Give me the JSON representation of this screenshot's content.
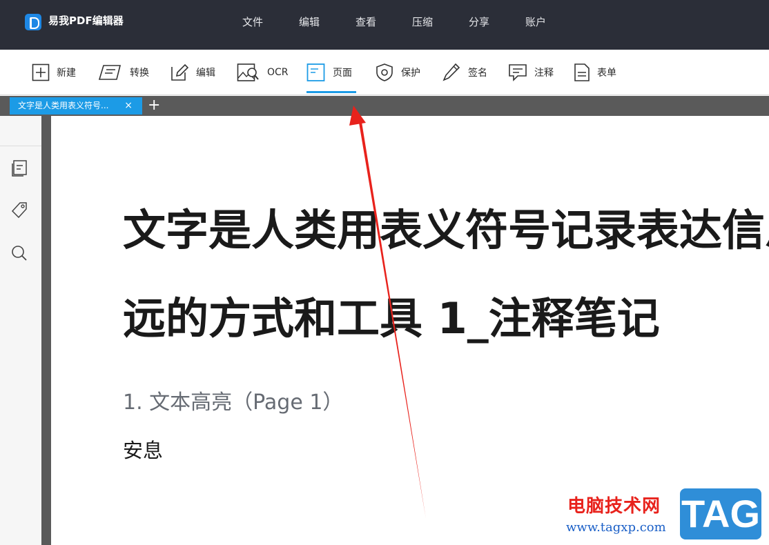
{
  "app": {
    "name": "易我PDF编辑器",
    "menu": [
      "文件",
      "编辑",
      "查看",
      "压缩",
      "分享",
      "账户"
    ]
  },
  "toolbar": {
    "tools": [
      {
        "label": "新建",
        "icon": "new-plus-icon"
      },
      {
        "label": "转换",
        "icon": "convert-icon"
      },
      {
        "label": "编辑",
        "icon": "edit-pencil-icon"
      },
      {
        "label": "OCR",
        "icon": "ocr-image-search-icon"
      },
      {
        "label": "页面",
        "icon": "page-icon",
        "active": true
      },
      {
        "label": "保护",
        "icon": "shield-icon"
      },
      {
        "label": "签名",
        "icon": "pen-icon"
      },
      {
        "label": "注释",
        "icon": "comment-icon"
      },
      {
        "label": "表单",
        "icon": "form-document-icon"
      }
    ],
    "active_color": "#1c9be6"
  },
  "tabs": {
    "doc_tab_title": "文字是人类用表义符号...",
    "close_glyph": "×",
    "new_tab_glyph": "+"
  },
  "sidebar": {
    "icons": [
      "thumbnails-icon",
      "tag-icon",
      "search-icon"
    ]
  },
  "document": {
    "title_line1": "文字是人类用表义符号记录表达信息以传之久",
    "title_line2": "远的方式和工具 1_注释笔记",
    "heading": "1. 文本高亮（Page 1）",
    "body": "安息"
  },
  "watermark": {
    "site": "电脑技术网",
    "url": "www.tagxp.com",
    "badge": "TAG"
  },
  "colors": {
    "titlebar": "#2b2e38",
    "accent": "#1c9be6",
    "arrow": "#e8221c"
  }
}
